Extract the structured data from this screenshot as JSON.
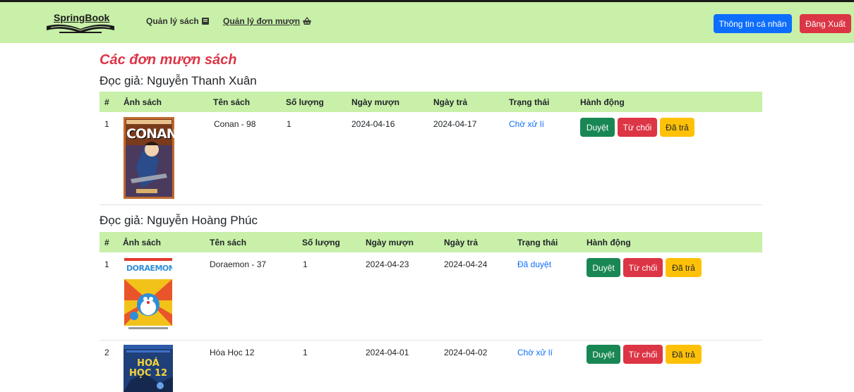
{
  "navbar": {
    "brand": "SpringBook",
    "links": [
      {
        "label": "Quản lý sách",
        "icon": "book-icon"
      },
      {
        "label": "Quản lý đơn mượn",
        "icon": "basket-icon"
      }
    ],
    "profile_button": "Thông tin cá nhân",
    "logout_button": "Đăng Xuất"
  },
  "page_title": "Các đơn mượn sách",
  "columns_headers": [
    "#",
    "Ảnh sách",
    "Tên sách",
    "Số lượng",
    "Ngày mượn",
    "Ngày trả",
    "Trạng thái",
    "Hành động"
  ],
  "actions": {
    "approve": "Duyệt",
    "reject": "Từ chối",
    "returned": "Đã trả"
  },
  "groups": [
    {
      "reader": "Đọc giả: Nguyễn Thanh Xuân",
      "rows": [
        {
          "index": "1",
          "title": "Conan - 98",
          "quantity": "1",
          "borrow_date": "2024-04-16",
          "return_date": "2024-04-17",
          "status": "Chờ xử lí",
          "cover_text": "CONAN"
        }
      ]
    },
    {
      "reader": "Đọc giả: Nguyễn Hoàng Phúc",
      "rows": [
        {
          "index": "1",
          "title": "Doraemon - 37",
          "quantity": "1",
          "borrow_date": "2024-04-23",
          "return_date": "2024-04-24",
          "status": "Đã duyệt",
          "cover_text": "DORAEMON"
        },
        {
          "index": "2",
          "title": "Hóa Học 12",
          "quantity": "1",
          "borrow_date": "2024-04-01",
          "return_date": "2024-04-02",
          "status": "Chờ xử lí",
          "cover_text": "HOÁ HỌC 12"
        }
      ]
    }
  ],
  "colors": {
    "navbar": "#c8f0a8",
    "title": "#dc3545",
    "status": "#0d6efd"
  }
}
